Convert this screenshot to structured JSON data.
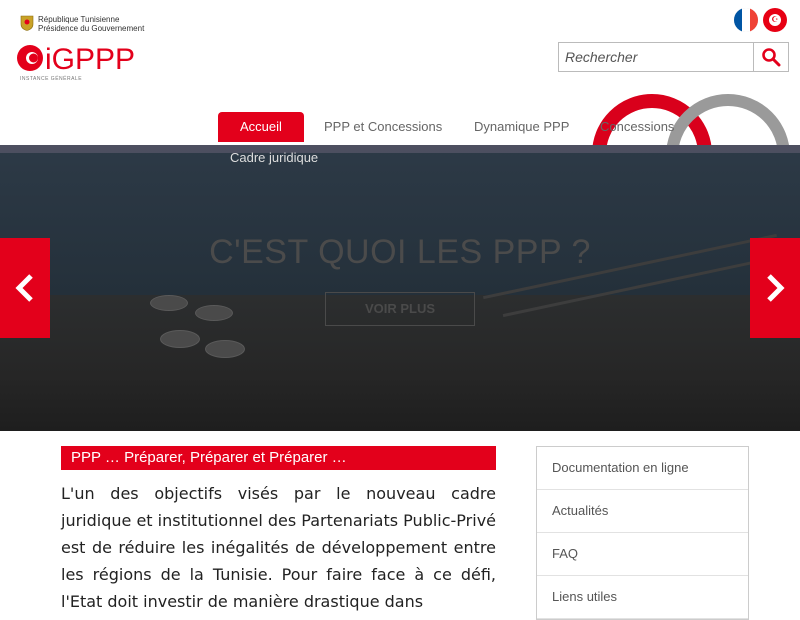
{
  "header": {
    "republic_line1": "République Tunisienne",
    "republic_line2": "Présidence du Gouvernement",
    "logo_text": "iGPPP",
    "logo_subtext": "INSTANCE GÉNÉRALE",
    "lang_fr": "Français",
    "lang_ar": "العربية"
  },
  "search": {
    "placeholder": "Rechercher"
  },
  "nav": {
    "items": [
      {
        "label": "Accueil"
      },
      {
        "label": "PPP et Concessions"
      },
      {
        "label": "Dynamique PPP"
      },
      {
        "label": "Concessions"
      },
      {
        "label": "Cadre juridique"
      }
    ]
  },
  "hero": {
    "title": "C'EST QUOI LES PPP ?",
    "button": "VOIR PLUS"
  },
  "main": {
    "section_title": "PPP … Préparer, Préparer et Préparer …",
    "body": "L'un des objectifs visés par le nouveau cadre juridique et institutionnel des Partenariats Public-Privé est de réduire les inégalités de développement entre les régions de la Tunisie. Pour faire face à ce défi, l'Etat doit investir de manière drastique dans"
  },
  "sidebar": {
    "items": [
      {
        "label": "Documentation en ligne"
      },
      {
        "label": "Actualités"
      },
      {
        "label": "FAQ"
      },
      {
        "label": "Liens utiles"
      }
    ]
  },
  "colors": {
    "accent": "#e3001b",
    "grey_arc": "#9a9a9a",
    "hero_dark": "#1f2630"
  }
}
